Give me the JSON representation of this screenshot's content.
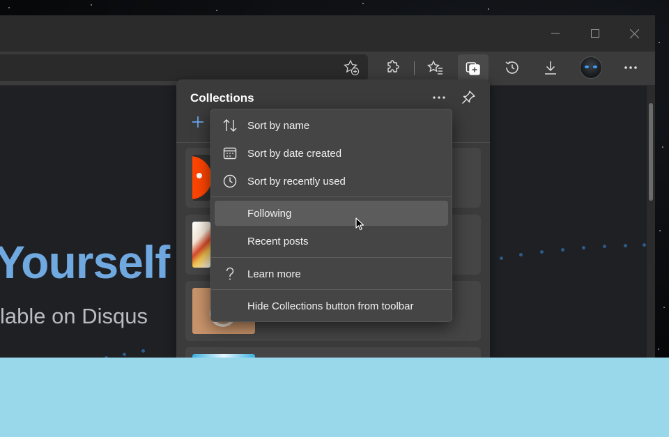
{
  "window": {
    "controls": {
      "minimize": "minimize",
      "maximize": "maximize",
      "close": "close"
    }
  },
  "toolbar": {
    "buttons": [
      "add-favorite",
      "extensions",
      "favorites",
      "collections",
      "history",
      "downloads",
      "profile",
      "settings-more"
    ],
    "active": "collections"
  },
  "page": {
    "headline": "Yourself",
    "subline": "lable on Disqus"
  },
  "collections_panel": {
    "title": "Collections",
    "more_icon": "ellipsis-icon",
    "pin_icon": "pin-icon",
    "add_icon": "plus-icon"
  },
  "context_menu": {
    "sort_by_name": "Sort by name",
    "sort_by_date_created": "Sort by date created",
    "sort_by_recently_used": "Sort by recently used",
    "following": "Following",
    "recent_posts": "Recent posts",
    "learn_more": "Learn more",
    "hide_button": "Hide Collections button from toolbar"
  },
  "colors": {
    "accent": "#6fa9e0",
    "panel_bg": "#3b3b3b",
    "menu_bg": "#454545",
    "menu_hover": "#5c5c5c",
    "desktop_band": "#98d8ea"
  }
}
